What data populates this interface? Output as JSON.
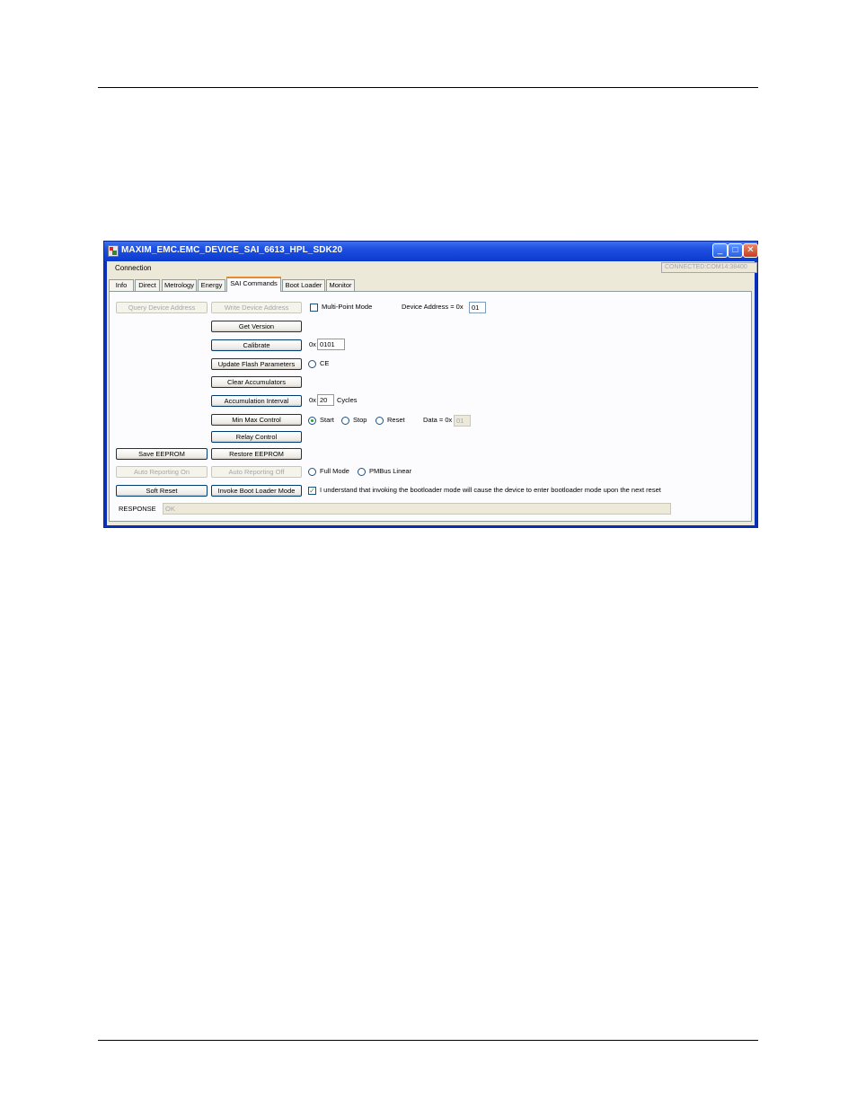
{
  "window": {
    "title": "MAXIM_EMC.EMC_DEVICE_SAI_6613_HPL_SDK20",
    "controls": {
      "minimize": "_",
      "maximize": "□",
      "close": "✕"
    }
  },
  "menu": {
    "connection": "Connection"
  },
  "status": {
    "connection": "CONNECTED:COM14:38400"
  },
  "tabs": [
    "Info",
    "Direct",
    "Metrology",
    "Energy",
    "SAI Commands",
    "Boot Loader",
    "Monitor"
  ],
  "active_tab": "SAI Commands",
  "sai": {
    "query_device_address": "Query Device Address",
    "write_device_address": "Write Device Address",
    "multi_point_mode": "Multi-Point Mode",
    "multi_point_checked": false,
    "device_address_label": "Device Address = 0x",
    "device_address_value": "01",
    "get_version": "Get Version",
    "calibrate": "Calibrate",
    "calibrate_prefix": "0x",
    "calibrate_value": "0101",
    "update_flash": "Update Flash Parameters",
    "ce_label": "CE",
    "clear_accumulators": "Clear Accumulators",
    "accumulation_interval": "Accumulation Interval",
    "interval_prefix": "0x",
    "interval_value": "20",
    "interval_unit": "Cycles",
    "min_max_control": "Min Max Control",
    "start": "Start",
    "stop": "Stop",
    "reset": "Reset",
    "data_label": "Data = 0x",
    "data_value": "01",
    "relay_control": "Relay Control",
    "save_eeprom": "Save EEPROM",
    "restore_eeprom": "Restore EEPROM",
    "auto_reporting_on": "Auto Reporting On",
    "auto_reporting_off": "Auto Reporting Off",
    "full_mode": "Full Mode",
    "pmbus_linear": "PMBus Linear",
    "soft_reset": "Soft Reset",
    "invoke_boot_loader": "Invoke Boot Loader Mode",
    "bootloader_ack": "I understand that invoking the bootloader mode will cause the device to enter bootloader mode upon the next reset",
    "bootloader_ack_checked": true,
    "response_label": "RESPONSE",
    "response_value": "OK"
  }
}
